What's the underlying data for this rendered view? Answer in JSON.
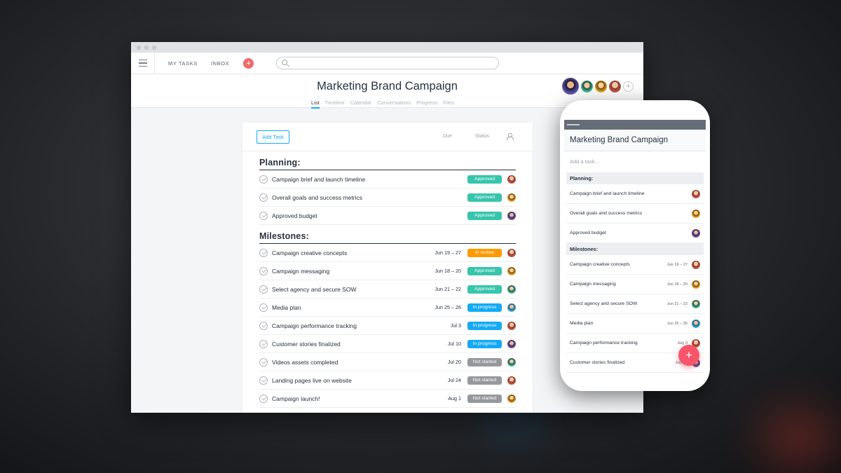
{
  "colors": {
    "approved": "#37c5ab",
    "in_review": "#fd9a00",
    "in_progress": "#14aaf5",
    "not_started": "#95999e",
    "accent": "#f06a6a",
    "link": "#14aaf5"
  },
  "topnav": {
    "menu_icon": "hamburger-icon",
    "my_tasks": "MY TASKS",
    "inbox": "INBOX",
    "add_icon": "plus-icon",
    "search_placeholder": ""
  },
  "project": {
    "title": "Marketing Brand Campaign",
    "tabs": [
      {
        "label": "List",
        "active": true
      },
      {
        "label": "Timeline"
      },
      {
        "label": "Calendar"
      },
      {
        "label": "Conversations"
      },
      {
        "label": "Progress"
      },
      {
        "label": "Files"
      }
    ],
    "add_member_icon": "plus-icon"
  },
  "list": {
    "add_task": "Add Task",
    "col_due": "Due",
    "col_status": "Status",
    "col_assignee_icon": "person-icon",
    "sections": [
      {
        "title": "Planning:",
        "tasks": [
          {
            "name": "Campaign brief and launch timeline",
            "due": "",
            "status": "Approved",
            "avatar": "av-a"
          },
          {
            "name": "Overall goals and success metrics",
            "due": "",
            "status": "Approved",
            "avatar": "av-b"
          },
          {
            "name": "Approved budget",
            "due": "",
            "status": "Approved",
            "avatar": "av-c"
          }
        ]
      },
      {
        "title": "Milestones:",
        "tasks": [
          {
            "name": "Campaign creative concepts",
            "due": "Jun 19 – 27",
            "status": "In review",
            "avatar": "av-a"
          },
          {
            "name": "Campaign messaging",
            "due": "Jun 18 – 20",
            "status": "Approved",
            "avatar": "av-b"
          },
          {
            "name": "Select agency and secure SOW",
            "due": "Jun 21 – 22",
            "status": "Approved",
            "avatar": "av-d"
          },
          {
            "name": "Media plan",
            "due": "Jun 25 – 26",
            "status": "In progress",
            "avatar": "av-e"
          },
          {
            "name": "Campaign performance tracking",
            "due": "Jul 3",
            "status": "In progress",
            "avatar": "av-a"
          },
          {
            "name": "Customer stories finalized",
            "due": "Jul 10",
            "status": "In progress",
            "avatar": "av-c"
          },
          {
            "name": "Videos assets completed",
            "due": "Jul 20",
            "status": "Not started",
            "avatar": "av-d"
          },
          {
            "name": "Landing pages live on website",
            "due": "Jul 24",
            "status": "Not started",
            "avatar": "av-a"
          },
          {
            "name": "Campaign launch!",
            "due": "Aug 1",
            "status": "Not started",
            "avatar": "av-b"
          }
        ]
      }
    ]
  },
  "mobile": {
    "title": "Marketing Brand Campaign",
    "add_placeholder": "Add a task...",
    "sections": [
      {
        "title": "Planning:",
        "tasks": [
          {
            "name": "Campaign brief and launch timeline",
            "due": "",
            "avatar": "av-a"
          },
          {
            "name": "Overall goals and success metrics",
            "due": "",
            "avatar": "av-b"
          },
          {
            "name": "Approved budget",
            "due": "",
            "avatar": "av-c"
          }
        ]
      },
      {
        "title": "Milestones:",
        "tasks": [
          {
            "name": "Campaign creative concepts",
            "due": "Jun 19 – 27",
            "avatar": "av-a"
          },
          {
            "name": "Campaign messaging",
            "due": "Jun 18 – 20",
            "avatar": "av-b"
          },
          {
            "name": "Select agency and secure SOW",
            "due": "Jun 21 – 22",
            "avatar": "av-d"
          },
          {
            "name": "Media plan",
            "due": "Jun 25 – 26",
            "avatar": "av-e"
          },
          {
            "name": "Campaign performance tracking",
            "due": "July 3",
            "avatar": "av-a"
          },
          {
            "name": "Customer stories finalized",
            "due": "July 10",
            "avatar": "av-c"
          }
        ]
      }
    ],
    "fab_icon": "plus-icon"
  }
}
